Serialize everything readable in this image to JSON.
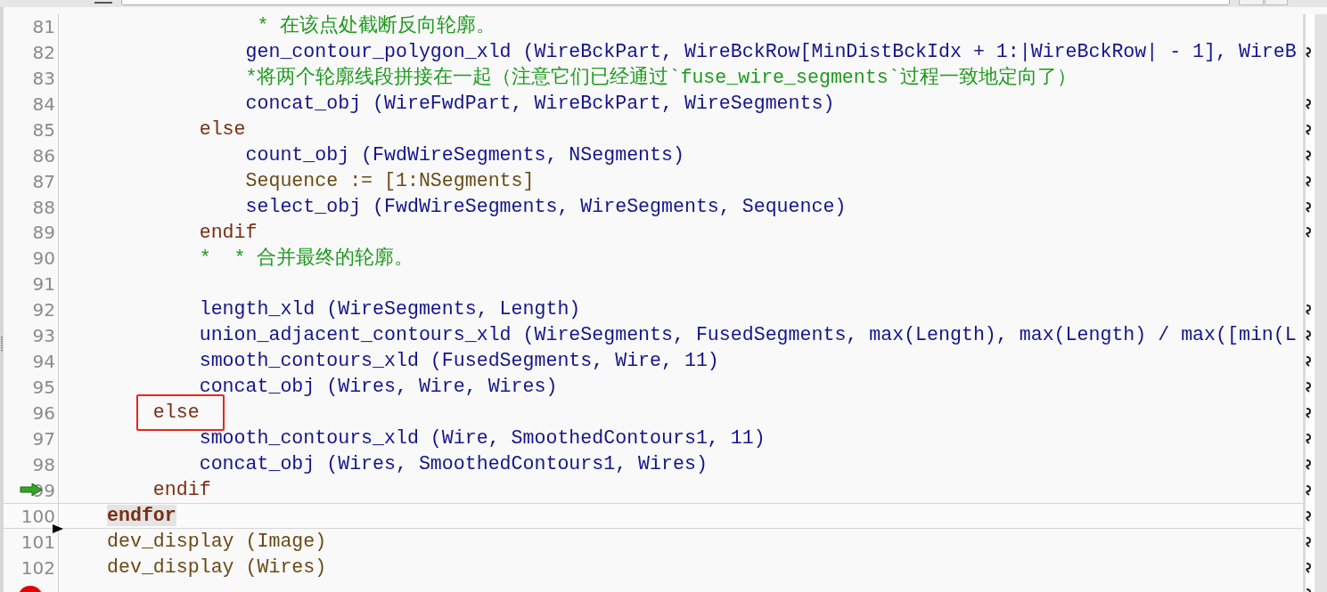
{
  "toolbar": {
    "field": {
      "kind": "field"
    }
  },
  "lines": [
    {
      "number": "81",
      "kind": "comment",
      "text": "             * 在该点处截断反向轮廓。",
      "selected": false,
      "pc": false,
      "breakpoint": false,
      "insert": false,
      "overflow": false,
      "annotated": false
    },
    {
      "number": "82",
      "kind": "call",
      "text": "            gen_contour_polygon_xld (WireBckPart, WireBckRow[MinDistBckIdx + 1:|WireBckRow| - 1], WireB",
      "selected": false,
      "pc": false,
      "breakpoint": false,
      "insert": false,
      "overflow": true,
      "annotated": false
    },
    {
      "number": "83",
      "kind": "comment",
      "text": "            *将两个轮廓线段拼接在一起（注意它们已经通过`fuse_wire_segments`过程一致地定向了）",
      "selected": false,
      "pc": false,
      "breakpoint": false,
      "insert": false,
      "overflow": false,
      "annotated": false
    },
    {
      "number": "84",
      "kind": "call",
      "text": "            concat_obj (WireFwdPart, WireBckPart, WireSegments)",
      "selected": false,
      "pc": false,
      "breakpoint": false,
      "insert": false,
      "overflow": true,
      "annotated": false
    },
    {
      "number": "85",
      "kind": "control",
      "text": "        else",
      "selected": false,
      "pc": false,
      "breakpoint": false,
      "insert": false,
      "overflow": true,
      "annotated": false
    },
    {
      "number": "86",
      "kind": "call",
      "text": "            count_obj (FwdWireSegments, NSegments)",
      "selected": false,
      "pc": false,
      "breakpoint": false,
      "insert": false,
      "overflow": true,
      "annotated": false
    },
    {
      "number": "87",
      "kind": "assign",
      "text": "            Sequence := [1:NSegments]",
      "selected": false,
      "pc": false,
      "breakpoint": false,
      "insert": false,
      "overflow": true,
      "annotated": false
    },
    {
      "number": "88",
      "kind": "call",
      "text": "            select_obj (FwdWireSegments, WireSegments, Sequence)",
      "selected": false,
      "pc": false,
      "breakpoint": false,
      "insert": false,
      "overflow": true,
      "annotated": false
    },
    {
      "number": "89",
      "kind": "control",
      "text": "        endif",
      "selected": false,
      "pc": false,
      "breakpoint": false,
      "insert": false,
      "overflow": true,
      "annotated": false
    },
    {
      "number": "90",
      "kind": "comment",
      "text": "        *  * 合并最终的轮廓。",
      "selected": false,
      "pc": false,
      "breakpoint": false,
      "insert": false,
      "overflow": false,
      "annotated": false
    },
    {
      "number": "91",
      "kind": "blank",
      "selected": false,
      "pc": false,
      "breakpoint": false,
      "insert": false,
      "overflow": false,
      "annotated": false
    },
    {
      "number": "92",
      "kind": "call",
      "text": "        length_xld (WireSegments, Length)",
      "selected": false,
      "pc": false,
      "breakpoint": false,
      "insert": false,
      "overflow": true,
      "annotated": false
    },
    {
      "number": "93",
      "kind": "call",
      "text": "        union_adjacent_contours_xld (WireSegments, FusedSegments, max(Length), max(Length) / max([min(L",
      "selected": false,
      "pc": false,
      "breakpoint": false,
      "insert": false,
      "overflow": true,
      "annotated": false
    },
    {
      "number": "94",
      "kind": "call",
      "text": "        smooth_contours_xld (FusedSegments, Wire, 11)",
      "selected": false,
      "pc": false,
      "breakpoint": false,
      "insert": false,
      "overflow": true,
      "annotated": false
    },
    {
      "number": "95",
      "kind": "call",
      "text": "        concat_obj (Wires, Wire, Wires)",
      "selected": false,
      "pc": false,
      "breakpoint": false,
      "insert": false,
      "overflow": true,
      "annotated": false
    },
    {
      "number": "96",
      "kind": "control",
      "text": "    else",
      "selected": false,
      "pc": false,
      "breakpoint": false,
      "insert": false,
      "overflow": true,
      "annotated": true
    },
    {
      "number": "97",
      "kind": "call",
      "text": "        smooth_contours_xld (Wire, SmoothedContours1, 11)",
      "selected": false,
      "pc": false,
      "breakpoint": false,
      "insert": false,
      "overflow": true,
      "annotated": false
    },
    {
      "number": "98",
      "kind": "call",
      "text": "        concat_obj (Wires, SmoothedContours1, Wires)",
      "selected": false,
      "pc": false,
      "breakpoint": false,
      "insert": false,
      "overflow": true,
      "annotated": false
    },
    {
      "number": "99",
      "kind": "control",
      "text": "    endif",
      "selected": false,
      "pc": true,
      "breakpoint": false,
      "insert": false,
      "overflow": true,
      "annotated": false
    },
    {
      "number": "100",
      "kind": "control",
      "text": "endfor",
      "selected": true,
      "pc": false,
      "breakpoint": false,
      "insert": false,
      "overflow": true,
      "annotated": false
    },
    {
      "number": "101",
      "kind": "display",
      "text": "dev_display (Image)",
      "selected": false,
      "pc": false,
      "breakpoint": false,
      "insert": true,
      "overflow": true,
      "annotated": false
    },
    {
      "number": "102",
      "kind": "display",
      "text": "dev_display (Wires)",
      "selected": false,
      "pc": false,
      "breakpoint": false,
      "insert": false,
      "overflow": true,
      "annotated": false
    },
    {
      "kind": "control",
      "selected": false,
      "pc": false,
      "breakpoint": true,
      "insert": false,
      "overflow": true,
      "annotated": false
    }
  ]
}
